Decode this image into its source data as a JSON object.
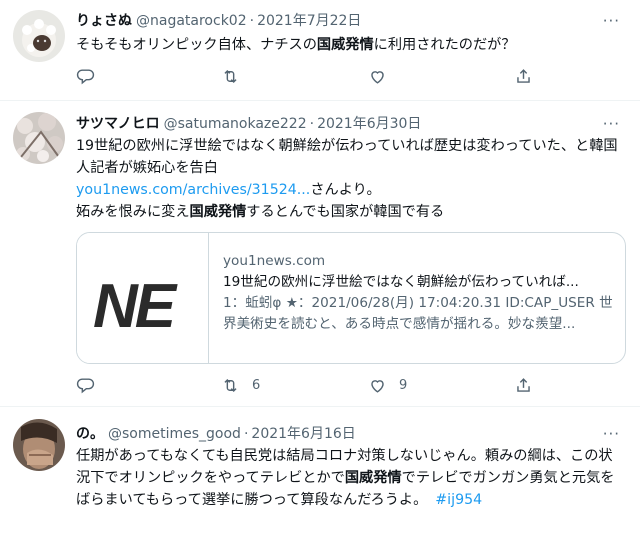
{
  "tweets": [
    {
      "name": "りょさぬ",
      "handle": "@nagatarock02",
      "date": "2021年7月22日",
      "text_before": "そもそもオリンピック自体、ナチスの",
      "keyword": "国威発情",
      "text_after": "に利用されたのだが？",
      "counts": {
        "retweets": "",
        "likes": ""
      }
    },
    {
      "name": "サツマノヒロ",
      "handle": "@satumanokaze222",
      "date": "2021年6月30日",
      "line1": "19世紀の欧州に浮世絵ではなく朝鮮絵が伝わっていれば歴史は変わっていた、と韓国人記者が嫉妬心を告白",
      "link": "you1news.com/archives/31524...",
      "link_suffix": "さんより。",
      "line3_before": "妬みを恨みに変え",
      "keyword": "国威発情",
      "line3_after": "するとんでも国家が韓国で有る",
      "card": {
        "logo": "NE",
        "domain": "you1news.com",
        "title": "19世紀の欧州に浮世絵ではなく朝鮮絵が伝わっていれば...",
        "description": "1：蚯蚓φ ★：2021/06/28(月) 17:04:20.31 ID:CAP_USER 世界美術史を読むと、ある時点で感情が揺れる。妙な羨望..."
      },
      "counts": {
        "retweets": "6",
        "likes": "9"
      }
    },
    {
      "name": "の。",
      "handle": "@sometimes_good",
      "date": "2021年6月16日",
      "text_before": "任期があってもなくても自民党は結局コロナ対策しないじゃん。頼みの綱は、この状況下でオリンピックをやってテレビとかで",
      "keyword": "国威発情",
      "text_after": "でテレビでガンガン勇気と元気をばらまいてもらって選挙に勝つって算段なんだろうよ。",
      "hashtag": "#ij954"
    }
  ],
  "icons": [
    "reply-icon",
    "retweet-icon",
    "like-icon",
    "share-icon",
    "more-icon"
  ],
  "colors": {
    "text": "#0f1419",
    "secondary": "#536471",
    "link": "#1d9bf0",
    "border": "#eff3f4"
  }
}
